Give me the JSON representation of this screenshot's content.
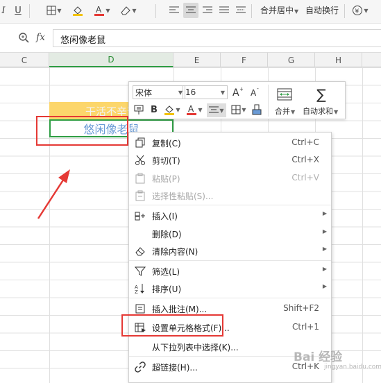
{
  "ribbon": {
    "merge_center_label": "合并居中",
    "wrap_text_label": "自动换行"
  },
  "formula_bar": {
    "fx_label": "fx",
    "value": "悠闲像老鼠"
  },
  "columns": [
    "C",
    "D",
    "E",
    "F",
    "G",
    "H"
  ],
  "cells": {
    "D3": "干活不辛苦",
    "D4": "悠闲像老鼠"
  },
  "mini_toolbar": {
    "font_name": "宋体",
    "font_size": "16",
    "merge_label": "合并",
    "autosum_label": "自动求和"
  },
  "context_menu": {
    "items": [
      {
        "label": "复制(C)",
        "shortcut": "Ctrl+C",
        "icon": "copy-icon"
      },
      {
        "label": "剪切(T)",
        "shortcut": "Ctrl+X",
        "icon": "scissors-icon"
      },
      {
        "label": "粘贴(P)",
        "shortcut": "Ctrl+V",
        "icon": "paste-icon",
        "disabled": true
      },
      {
        "label": "选择性粘贴(S)...",
        "shortcut": "",
        "icon": "paste-special-icon",
        "disabled": true
      },
      {
        "label": "插入(I)",
        "shortcut": "",
        "icon": "insert-icon",
        "submenu": true
      },
      {
        "label": "删除(D)",
        "shortcut": "",
        "icon": "",
        "submenu": true
      },
      {
        "label": "清除内容(N)",
        "shortcut": "",
        "icon": "eraser-icon",
        "submenu": true
      },
      {
        "label": "筛选(L)",
        "shortcut": "",
        "icon": "filter-icon",
        "submenu": true
      },
      {
        "label": "排序(U)",
        "shortcut": "",
        "icon": "sort-icon",
        "submenu": true
      },
      {
        "label": "插入批注(M)...",
        "shortcut": "Shift+F2",
        "icon": "comment-icon"
      },
      {
        "label": "设置单元格格式(F)...",
        "shortcut": "Ctrl+1",
        "icon": "format-cells-icon"
      },
      {
        "label": "从下拉列表中选择(K)...",
        "shortcut": "",
        "icon": ""
      },
      {
        "label": "超链接(H)...",
        "shortcut": "Ctrl+K",
        "icon": "link-icon"
      }
    ]
  },
  "colors": {
    "selection_green": "#2f9e44",
    "highlight_red": "#e53935",
    "cell_yellow": "#fcd66b"
  }
}
